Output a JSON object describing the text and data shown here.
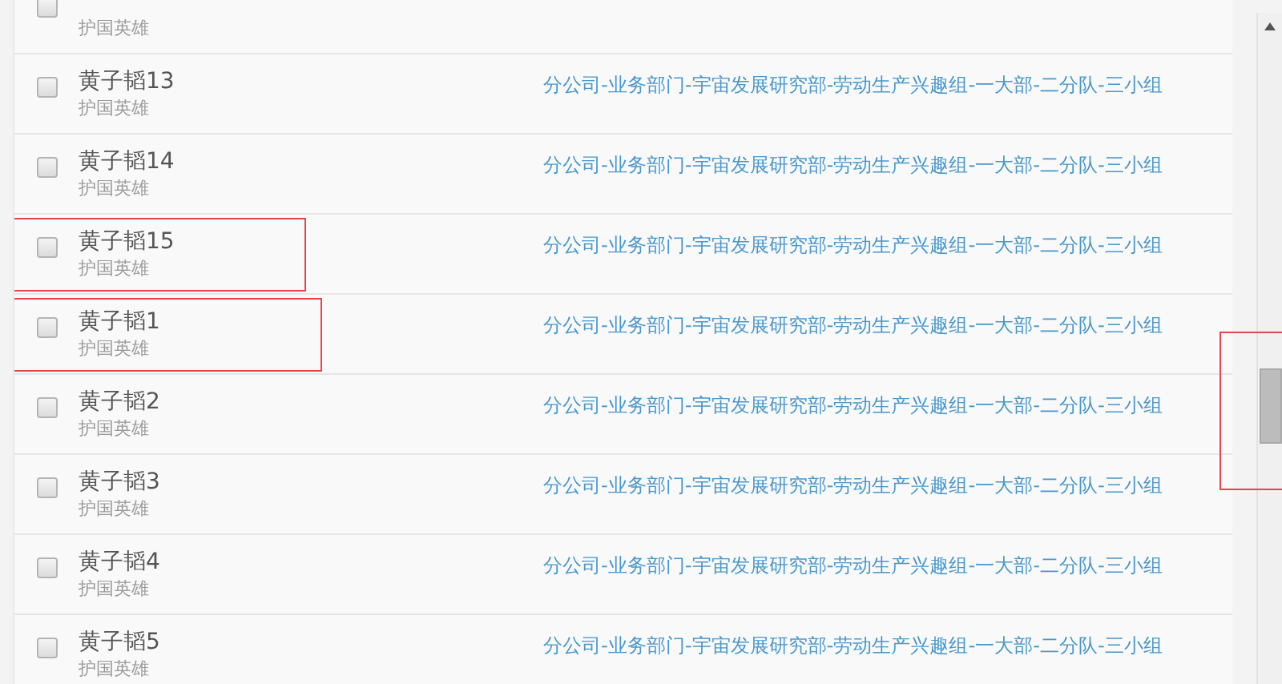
{
  "rows": [
    {
      "title": "护国英雄",
      "checked": false,
      "highlighted": false
    },
    {
      "name": "黄子韬13",
      "title": "护国英雄",
      "path": "分公司-业务部门-宇宙发展研究部-劳动生产兴趣组-一大部-二分队-三小组",
      "checked": false,
      "highlighted": false
    },
    {
      "name": "黄子韬14",
      "title": "护国英雄",
      "path": "分公司-业务部门-宇宙发展研究部-劳动生产兴趣组-一大部-二分队-三小组",
      "checked": false,
      "highlighted": false
    },
    {
      "name": "黄子韬15",
      "title": "护国英雄",
      "path": "分公司-业务部门-宇宙发展研究部-劳动生产兴趣组-一大部-二分队-三小组",
      "checked": false,
      "highlighted": true
    },
    {
      "name": "黄子韬1",
      "title": "护国英雄",
      "path": "分公司-业务部门-宇宙发展研究部-劳动生产兴趣组-一大部-二分队-三小组",
      "checked": false,
      "highlighted": true
    },
    {
      "name": "黄子韬2",
      "title": "护国英雄",
      "path": "分公司-业务部门-宇宙发展研究部-劳动生产兴趣组-一大部-二分队-三小组",
      "checked": false,
      "highlighted": false
    },
    {
      "name": "黄子韬3",
      "title": "护国英雄",
      "path": "分公司-业务部门-宇宙发展研究部-劳动生产兴趣组-一大部-二分队-三小组",
      "checked": false,
      "highlighted": false
    },
    {
      "name": "黄子韬4",
      "title": "护国英雄",
      "path": "分公司-业务部门-宇宙发展研究部-劳动生产兴趣组-一大部-二分队-三小组",
      "checked": false,
      "highlighted": false
    },
    {
      "name": "黄子韬5",
      "title": "护国英雄",
      "path": "分公司-业务部门-宇宙发展研究部-劳动生产兴趣组-一大部-二分队-三小组",
      "checked": false,
      "highlighted": false
    }
  ],
  "scrollbar": {
    "highlighted": true
  }
}
